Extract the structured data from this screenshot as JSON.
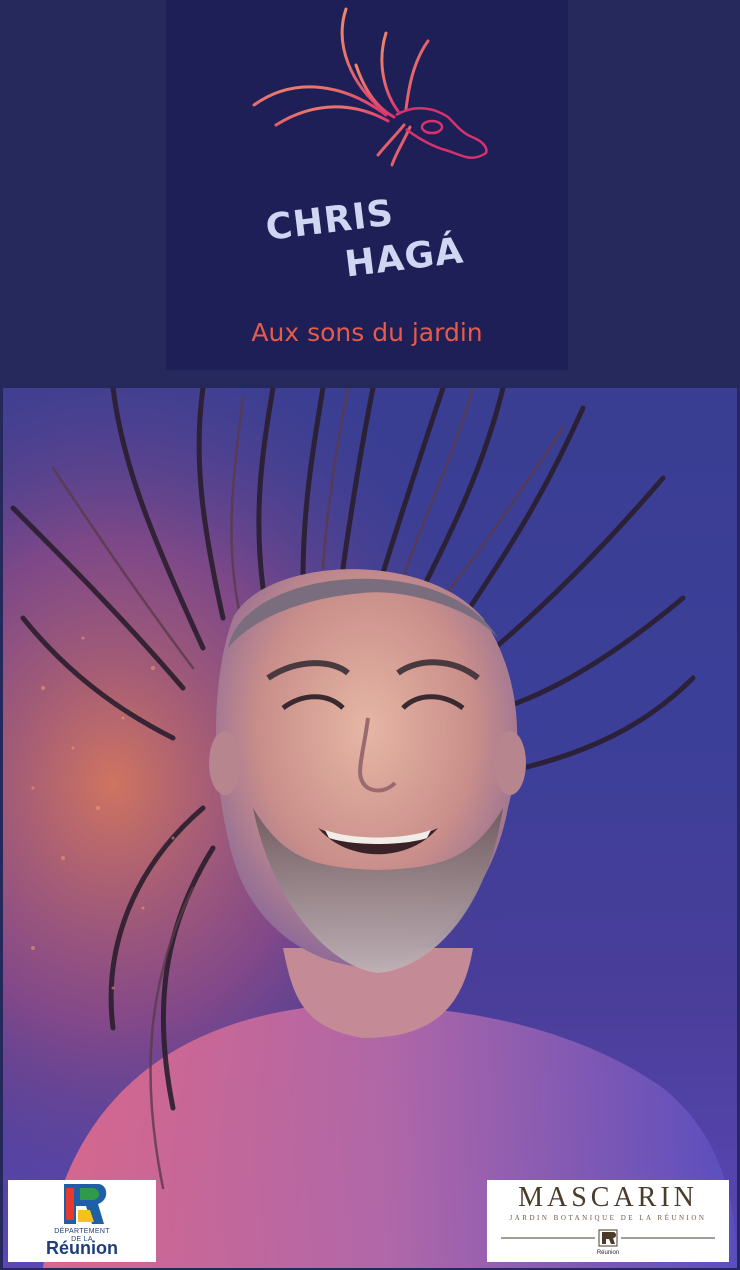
{
  "header": {
    "artist_line1": "CHRIS",
    "artist_line2": "HAGÁ",
    "tagline": "Aux sons du jardin"
  },
  "photo": {
    "subject": "portrait-photo"
  },
  "sponsors": {
    "reunion": {
      "small_line1": "DÉPARTEMENT",
      "small_line2": "DE LA",
      "name": "Réunion"
    },
    "mascarin": {
      "name": "MASCARIN",
      "subtitle": "JARDIN BOTANIQUE DE LA RÉUNION",
      "mini": "Réunion"
    }
  },
  "colors": {
    "background": "#25285a",
    "logo_panel": "#1d1f56",
    "tagline": "#e85a4a",
    "brand_text": "#cfd6f2"
  }
}
